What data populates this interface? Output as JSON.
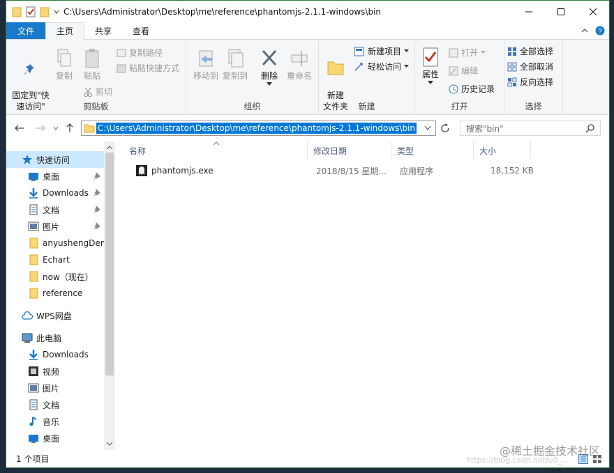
{
  "title_bar": {
    "path": "C:\\Users\\Administrator\\Desktop\\me\\reference\\phantomjs-2.1.1-windows\\bin"
  },
  "tabs": [
    {
      "label": "文件"
    },
    {
      "label": "主页"
    },
    {
      "label": "共享"
    },
    {
      "label": "查看"
    }
  ],
  "ribbon": {
    "clipboard": {
      "label": "剪贴板",
      "pin": "固定到\"快\n速访问\"",
      "copy": "复制",
      "paste": "粘贴",
      "copy_path": "复制路径",
      "paste_shortcut": "粘贴快捷方式",
      "cut": "剪切"
    },
    "organize": {
      "label": "组织",
      "move_to": "移动到",
      "copy_to": "复制到",
      "delete": "删除",
      "rename": "重命名"
    },
    "new": {
      "label": "新建",
      "new_folder": "新建\n文件夹",
      "new_item": "新建项目",
      "easy_access": "轻松访问"
    },
    "open": {
      "label": "打开",
      "properties": "属性",
      "open": "打开",
      "edit": "编辑",
      "history": "历史记录"
    },
    "select": {
      "label": "选择",
      "select_all": "全部选择",
      "select_none": "全部取消",
      "invert": "反向选择"
    }
  },
  "address": {
    "path": "C:\\Users\\Administrator\\Desktop\\me\\reference\\phantomjs-2.1.1-windows\\bin",
    "search_placeholder": "搜索\"bin\""
  },
  "nav": {
    "quick_access": "快速访问",
    "quick_items": [
      "桌面",
      "Downloads",
      "文档",
      "图片",
      "anyushengDem",
      "Echart",
      "now（现在）",
      "reference"
    ],
    "wps": "WPS网盘",
    "this_pc": "此电脑",
    "pc_items": [
      "Downloads",
      "视频",
      "图片",
      "文档",
      "音乐",
      "桌面"
    ]
  },
  "columns": {
    "name": "名称",
    "date": "修改日期",
    "type": "类型",
    "size": "大小"
  },
  "files": [
    {
      "name": "phantomjs.exe",
      "date": "2018/8/15 星期...",
      "type": "应用程序",
      "size": "18,152 KB"
    }
  ],
  "status": {
    "count": "1 个项目"
  },
  "watermark": "@稀土掘金技术社区",
  "watermark_url": "https://blog.csdn.net/u0_..."
}
